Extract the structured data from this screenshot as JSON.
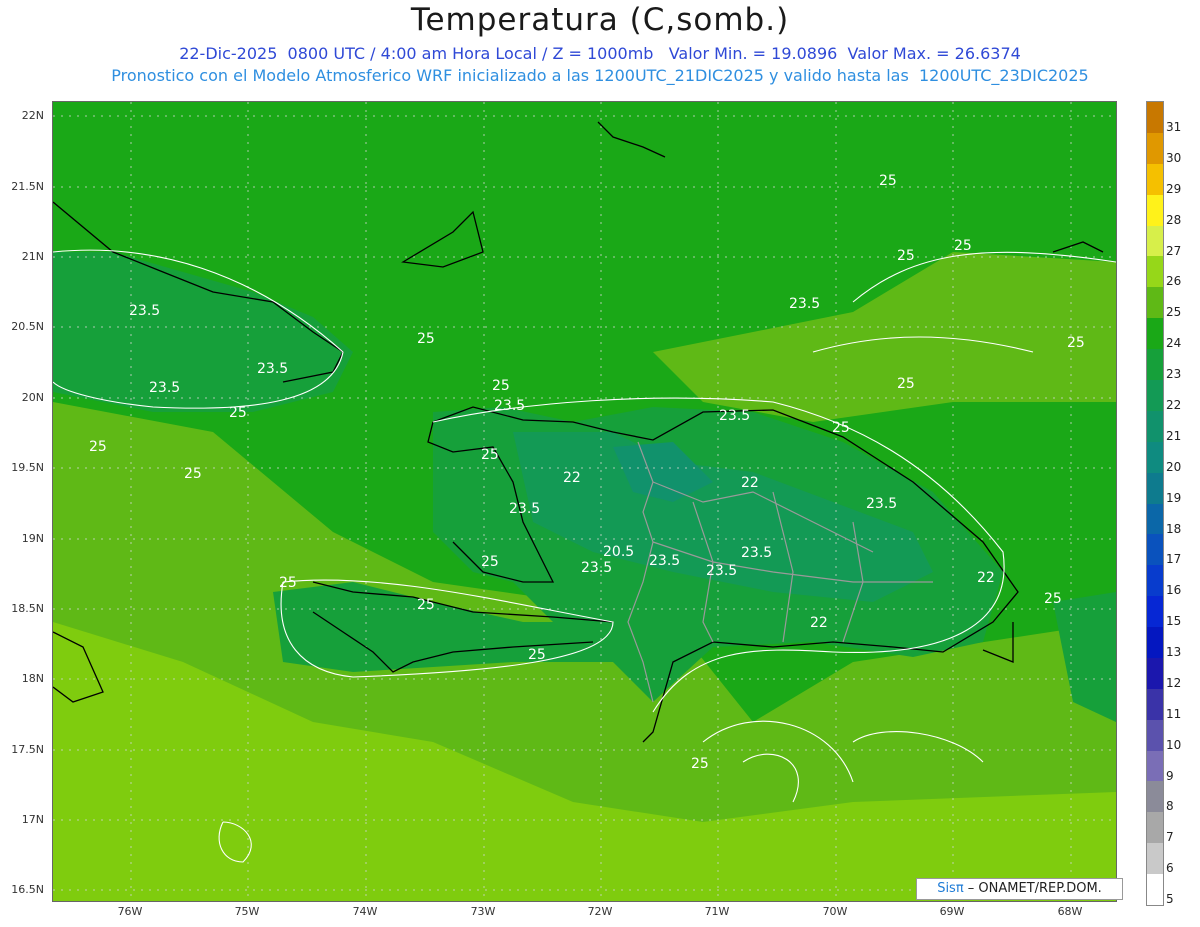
{
  "header": {
    "title": "Temperatura (C,somb.)",
    "line1": "22-Dic-2025  0800 UTC / 4:00 am Hora Local / Z = 1000mb   Valor Min. = 19.0896  Valor Max. = 26.6374",
    "line2": "Pronostico con el Modelo Atmosferico WRF inicializado a las 1200UTC_21DIC2025 y valido hasta las  1200UTC_23DIC2025"
  },
  "axes": {
    "lat_labels": [
      "22N",
      "21.5N",
      "21N",
      "20.5N",
      "20N",
      "19.5N",
      "19N",
      "18.5N",
      "18N",
      "17.5N",
      "17N",
      "16.5N"
    ],
    "lon_labels": [
      "76W",
      "75W",
      "74W",
      "73W",
      "72W",
      "71W",
      "70W",
      "69W",
      "68W"
    ]
  },
  "colorbar": {
    "labels": [
      "31",
      "30",
      "29",
      "28",
      "27",
      "26",
      "25",
      "24",
      "23",
      "22",
      "21",
      "20",
      "19",
      "18",
      "17",
      "16",
      "15",
      "13",
      "12",
      "11",
      "10",
      "9",
      "8",
      "7",
      "6",
      "5"
    ],
    "colors": [
      "#c87800",
      "#e09800",
      "#f5c000",
      "#fff21a",
      "#d7ef4a",
      "#96d719",
      "#5fb916",
      "#1aa817",
      "#16a03a",
      "#139a55",
      "#11926c",
      "#0f8b80",
      "#0e7b8e",
      "#0b67a8",
      "#0a52bd",
      "#083ccd",
      "#0627d4",
      "#0417c0",
      "#1b17ad",
      "#3a33a8",
      "#5b52ad",
      "#7a6eb6",
      "#8b8b99",
      "#a8a8a8",
      "#c9c9c9",
      "#ffffff"
    ]
  },
  "contour_labels": [
    "25",
    "25",
    "25",
    "25",
    "25",
    "25",
    "25",
    "25",
    "25",
    "25",
    "25",
    "25",
    "25",
    "25",
    "25",
    "25",
    "25",
    "25",
    "23.5",
    "23.5",
    "23.5",
    "23.5",
    "23.5",
    "23.5",
    "23.5",
    "23.5",
    "23.5",
    "23.5",
    "23.5",
    "23.5",
    "22",
    "22",
    "22",
    "22",
    "20.5"
  ],
  "credit": {
    "sis": "Sisπ",
    "text": " – ONAMET/REP.DOM."
  }
}
